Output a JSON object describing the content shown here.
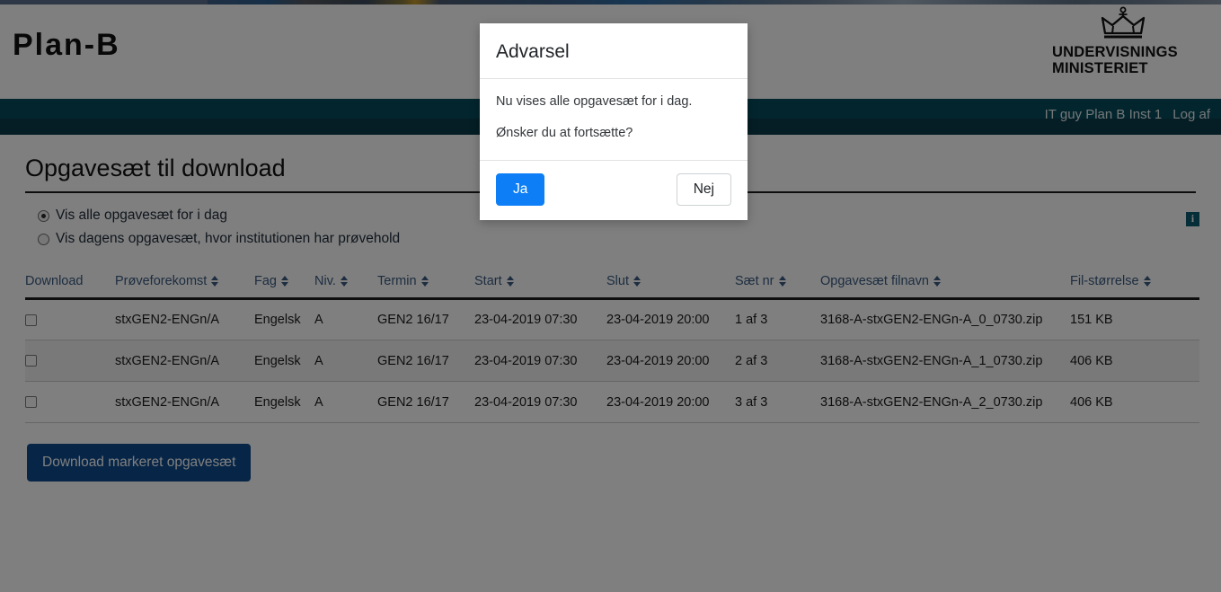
{
  "header": {
    "brand": "Plan-B",
    "ministry_logo": {
      "icon": "crown-icon",
      "name": "UNDERVISNINGS\nMINISTERIET"
    }
  },
  "navbar": {
    "user": "IT guy Plan B Inst 1",
    "logout": "Log af",
    "bg_color": "#064a5a",
    "bg_color_dark": "#0a3a4a"
  },
  "main": {
    "title": "Opgavesæt til download",
    "info_icon_label": "i",
    "options": [
      {
        "label": "Vis alle opgavesæt for i dag",
        "selected": true
      },
      {
        "label": "Vis dagens opgavesæt, hvor institutionen har prøvehold",
        "selected": false
      }
    ],
    "download_button": "Download markeret opgavesæt",
    "download_button_color": "#0d4a8f"
  },
  "table": {
    "columns": [
      {
        "label": "Download",
        "sortable": false
      },
      {
        "label": "Prøveforekomst",
        "sortable": true
      },
      {
        "label": "Fag",
        "sortable": true
      },
      {
        "label": "Niv.",
        "sortable": true
      },
      {
        "label": "Termin",
        "sortable": true
      },
      {
        "label": "Start",
        "sortable": true
      },
      {
        "label": "Slut",
        "sortable": true
      },
      {
        "label": "Sæt nr",
        "sortable": true
      },
      {
        "label": "Opgavesæt filnavn",
        "sortable": true
      },
      {
        "label": "Fil-størrelse",
        "sortable": true
      }
    ],
    "rows": [
      {
        "checked": false,
        "proveforekomst": "stxGEN2-ENGn/A",
        "fag": "Engelsk",
        "niv": "A",
        "termin": "GEN2 16/17",
        "start": "23-04-2019 07:30",
        "slut": "23-04-2019 20:00",
        "saet_nr": "1 af 3",
        "filnavn": "3168-A-stxGEN2-ENGn-A_0_0730.zip",
        "filstorrelse": "151 KB"
      },
      {
        "checked": false,
        "proveforekomst": "stxGEN2-ENGn/A",
        "fag": "Engelsk",
        "niv": "A",
        "termin": "GEN2 16/17",
        "start": "23-04-2019 07:30",
        "slut": "23-04-2019 20:00",
        "saet_nr": "2 af 3",
        "filnavn": "3168-A-stxGEN2-ENGn-A_1_0730.zip",
        "filstorrelse": "406 KB"
      },
      {
        "checked": false,
        "proveforekomst": "stxGEN2-ENGn/A",
        "fag": "Engelsk",
        "niv": "A",
        "termin": "GEN2 16/17",
        "start": "23-04-2019 07:30",
        "slut": "23-04-2019 20:00",
        "saet_nr": "3 af 3",
        "filnavn": "3168-A-stxGEN2-ENGn-A_2_0730.zip",
        "filstorrelse": "406 KB"
      }
    ]
  },
  "modal": {
    "title": "Advarsel",
    "body_line_1": "Nu vises alle opgavesæt for i dag.",
    "body_line_2": "Ønsker du at fortsætte?",
    "confirm_label": "Ja",
    "cancel_label": "Nej",
    "confirm_color": "#0d7ef5"
  }
}
